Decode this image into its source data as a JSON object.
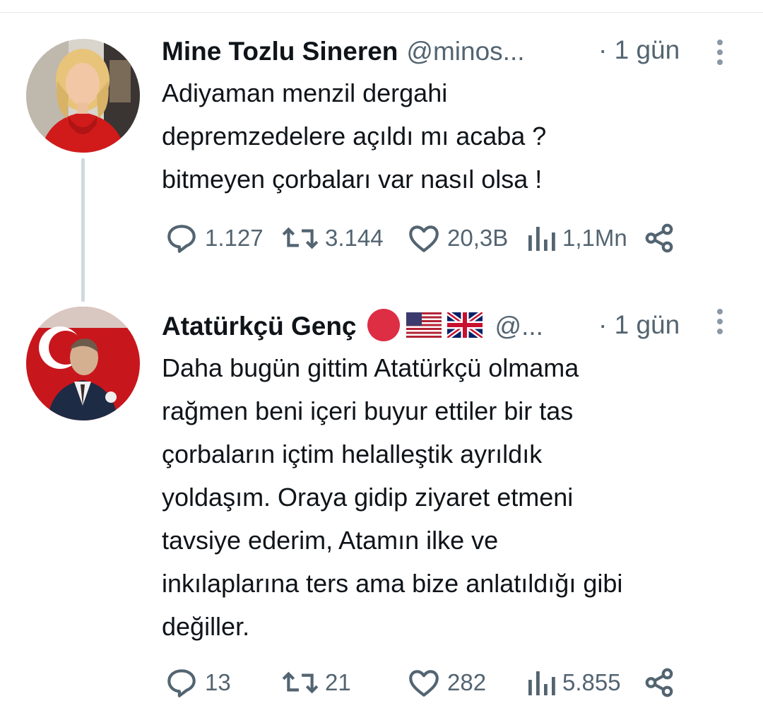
{
  "tweets": [
    {
      "name": "Mine Tozlu Sineren",
      "handle": "@minos...",
      "time": "· 1 gün",
      "text": "Adiyaman menzil dergahi\ndepremzedelere açıldı mı acaba ?\nbitmeyen çorbaları var nasıl olsa !",
      "replies": "1.127",
      "retweets": "3.144",
      "likes": "20,3B",
      "views": "1,1Mn",
      "avatar_icon": "woman-red-sweater-avatar"
    },
    {
      "name": "Atatürkçü Genç",
      "handle": "@...",
      "time": "· 1 gün",
      "badges": [
        "red-circle-emoji",
        "us-flag-emoji",
        "uk-flag-emoji"
      ],
      "text": "Daha bugün gittim Atatürkçü olmama\nrağmen beni içeri buyur ettiler bir tas\nçorbaların içtim helalleştik ayrıldık\nyoldaşım. Oraya gidip ziyaret etmeni\ntavsiye ederim, Atamın ilke ve\ninkılaplarına ters ama bize anlatıldığı gibi\ndeğiller.",
      "replies": "13",
      "retweets": "21",
      "likes": "282",
      "views": "5.855",
      "avatar_icon": "ataturk-flag-avatar"
    }
  ],
  "colors": {
    "text": "#0f1419",
    "secondary": "#536471",
    "divider": "#e7e9ea",
    "thread_line": "#cfd9de"
  }
}
